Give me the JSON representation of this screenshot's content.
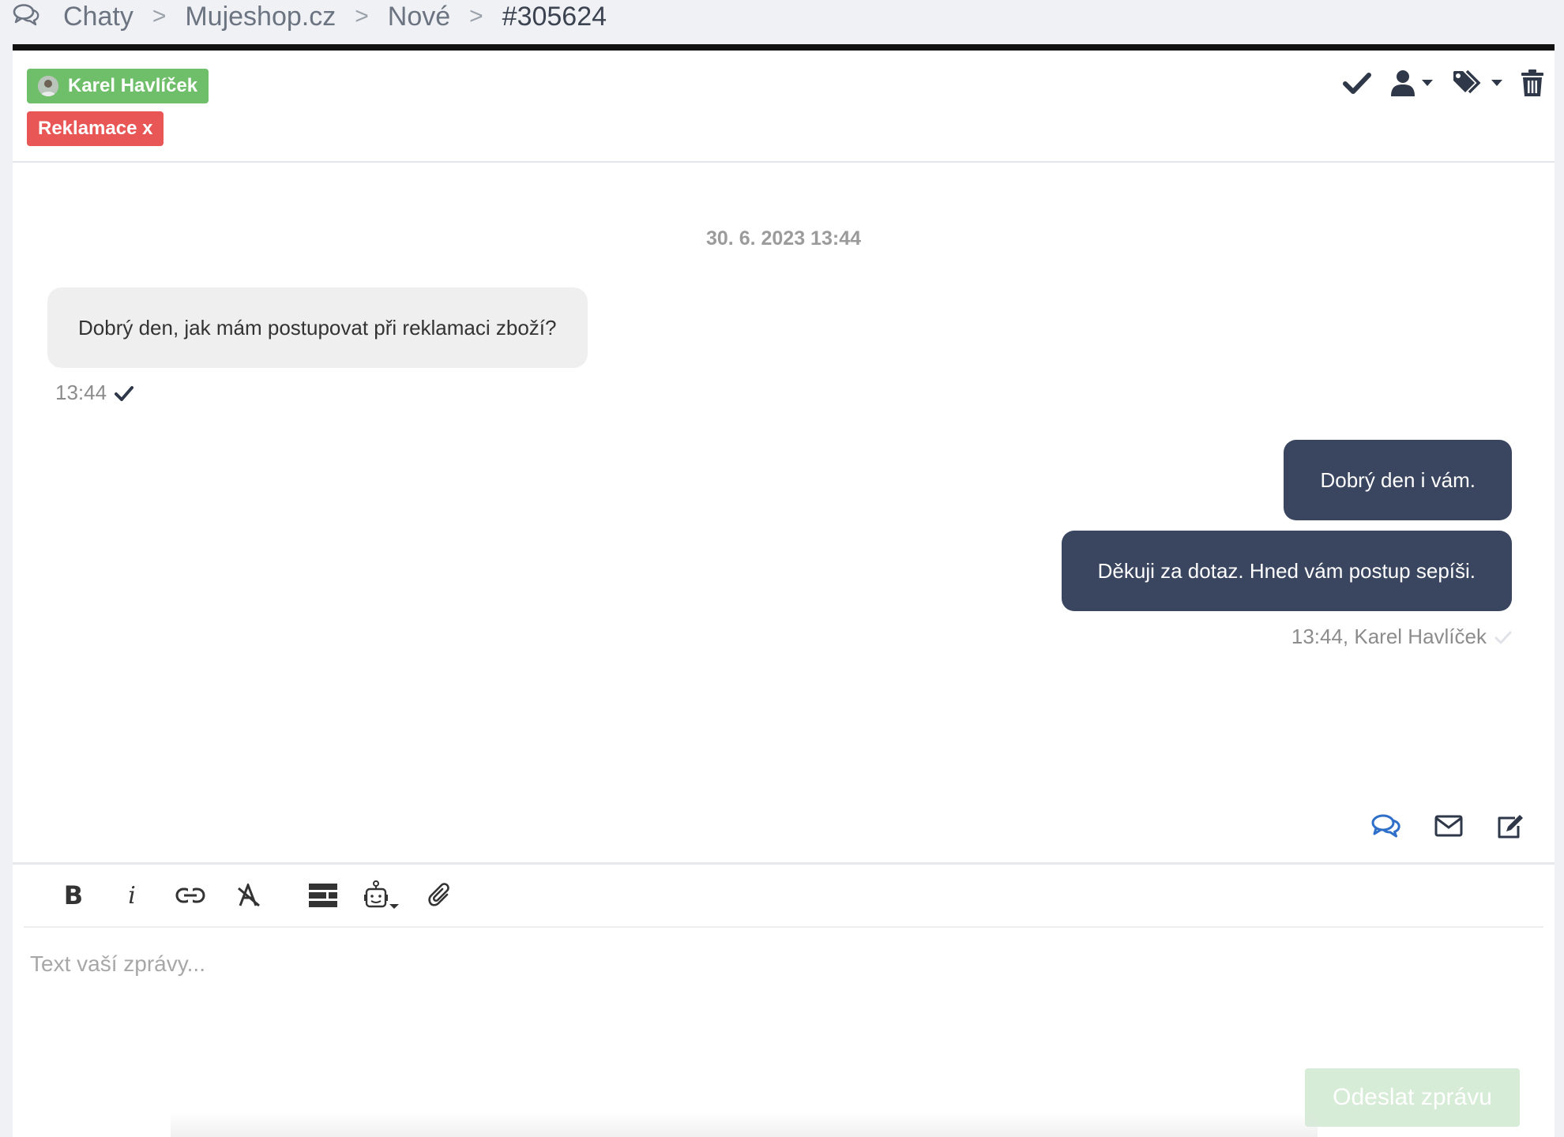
{
  "breadcrumb": {
    "icon": "chats-icon",
    "items": [
      "Chaty",
      "Mujeshop.cz",
      "Nové",
      "#305624"
    ],
    "separator": ">"
  },
  "header": {
    "user_tag": "Karel Havlíček",
    "label_tag": "Reklamace x",
    "actions": [
      "check-icon",
      "user-assign-icon",
      "tags-icon",
      "trash-icon"
    ],
    "colors": {
      "user_tag": "#6fbe6a",
      "label_tag": "#e85656",
      "top_bar": "#111111"
    }
  },
  "chat": {
    "date": "30. 6. 2023 13:44",
    "incoming": {
      "text": "Dobrý den, jak mám postupovat při reklamaci zboží?",
      "meta": "13:44"
    },
    "outgoing": [
      {
        "text": "Dobrý den i vám."
      },
      {
        "text": "Děkuji za dotaz. Hned vám postup sepíši."
      }
    ],
    "outgoing_meta": "13:44, Karel Havlíček",
    "colors": {
      "incoming_bg": "#efefef",
      "outgoing_bg": "#3a4660"
    }
  },
  "channels": [
    "chat-icon",
    "email-icon",
    "note-icon"
  ],
  "composer": {
    "toolbar": [
      "bold-icon",
      "italic-icon",
      "link-icon",
      "clear-format-icon",
      "templates-icon",
      "bot-icon",
      "attachment-icon"
    ],
    "bold_label": "B",
    "italic_label": "i",
    "placeholder": "Text vaší zprávy...",
    "send_label": "Odeslat zprávu",
    "send_color": "#d6ecd7"
  }
}
